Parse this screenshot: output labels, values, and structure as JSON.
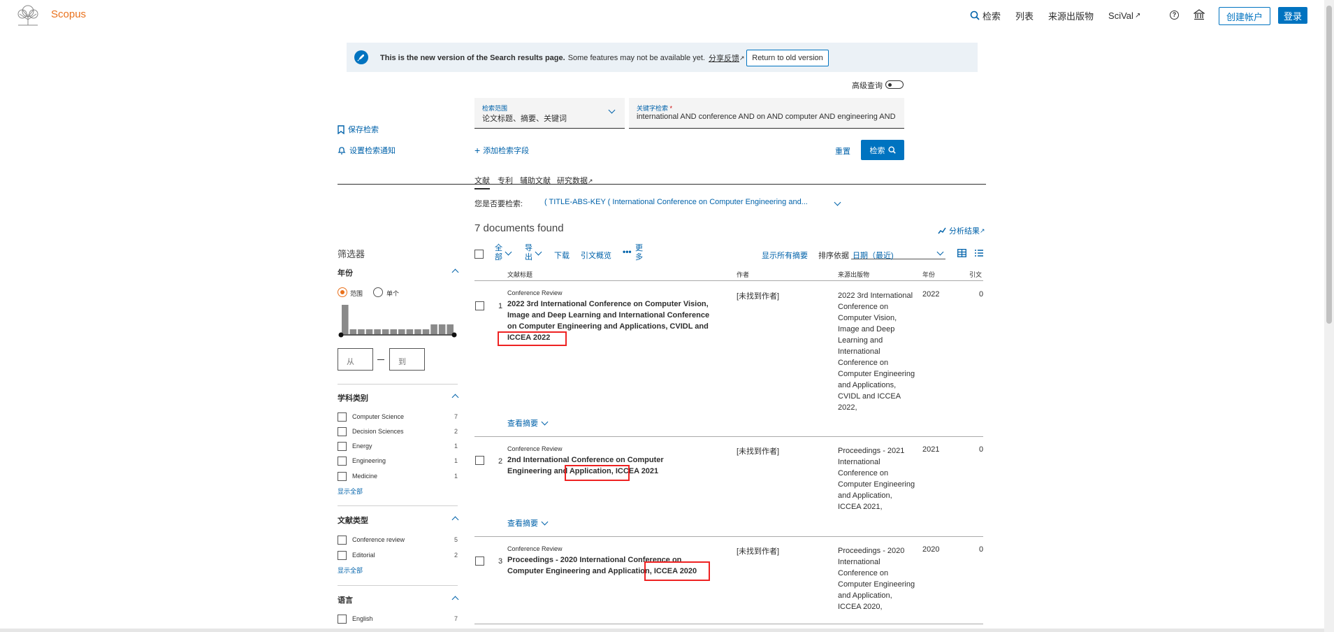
{
  "header": {
    "logo_text": "Scopus",
    "nav": [
      {
        "label": "检索"
      },
      {
        "label": "列表"
      },
      {
        "label": "来源出版物"
      },
      {
        "label": "SciVal"
      }
    ],
    "create_account": "创建帐户",
    "login": "登录"
  },
  "banner": {
    "bold_text": "This is the new version of the Search results page.",
    "text": "Some features may not be available yet.",
    "feedback_link": "分享反馈",
    "return_button": "Return to old version"
  },
  "advanced_toggle_label": "高级查询",
  "search": {
    "scope_label": "检索范围",
    "scope_value": "论文标题、摘要、关键词",
    "keyword_label": "关键字检索",
    "keyword_value": "international AND conference AND on AND computer AND engineering AND",
    "add_field": "添加检索字段",
    "reset": "重置",
    "search_button": "检索"
  },
  "left_actions": {
    "save_search": "保存检索",
    "set_alert": "设置检索通知"
  },
  "tabs": [
    {
      "label": "文献"
    },
    {
      "label": "专利"
    },
    {
      "label": "辅助文献"
    },
    {
      "label": "研究数据"
    }
  ],
  "suggest": {
    "label": "您是否要检索:",
    "query": "( TITLE-ABS-KEY ( International Conference on Computer Engineering and..."
  },
  "results": {
    "count_text": "7 documents found",
    "analyze": "分析结果",
    "toolbar": {
      "all": "全部",
      "export": "导出",
      "download": "下载",
      "citation_overview": "引文概览",
      "more": "更多",
      "show_all_abstracts": "显示所有摘要",
      "sort_label": "排序依据",
      "sort_value": "日期（最近)"
    },
    "columns": {
      "title": "文献标题",
      "authors": "作者",
      "source": "来源出版物",
      "year": "年份",
      "cited": "引文"
    },
    "rows": [
      {
        "num": "1",
        "type": "Conference Review",
        "title": "2022 3rd International Conference on Computer Vision, Image and Deep Learning and International Conference on Computer Engineering and Applications, CVIDL and ICCEA 2022",
        "authors": "[未找到作者]",
        "source": "2022 3rd International Conference on Computer Vision, Image and Deep Learning and International Conference on Computer Engineering and Applications, CVIDL and ICCEA 2022,",
        "year": "2022",
        "cited": "0",
        "abstract_link": "查看摘要"
      },
      {
        "num": "2",
        "type": "Conference Review",
        "title": "2nd International Conference on Computer Engineering and Application, ICCEA 2021",
        "authors": "[未找到作者]",
        "source": "Proceedings - 2021 International Conference on Computer Engineering and Application, ICCEA 2021,",
        "year": "2021",
        "cited": "0",
        "abstract_link": "查看摘要"
      },
      {
        "num": "3",
        "type": "Conference Review",
        "title": "Proceedings - 2020 International Conference on Computer Engineering and Application, ICCEA 2020",
        "authors": "[未找到作者]",
        "source": "Proceedings - 2020 International Conference on Computer Engineering and Application, ICCEA 2020,",
        "year": "2020",
        "cited": "0"
      }
    ]
  },
  "filters": {
    "title": "筛选器",
    "year": {
      "title": "年份",
      "range_label": "范围",
      "single_label": "单个",
      "from_placeholder": "从",
      "to_placeholder": "到",
      "histogram": [
        6,
        1,
        1,
        1,
        1,
        1,
        1,
        1,
        1,
        1,
        1,
        2,
        2,
        2
      ]
    },
    "subject": {
      "title": "学科类别",
      "items": [
        {
          "label": "Computer Science",
          "count": "7"
        },
        {
          "label": "Decision Sciences",
          "count": "2"
        },
        {
          "label": "Energy",
          "count": "1"
        },
        {
          "label": "Engineering",
          "count": "1"
        },
        {
          "label": "Medicine",
          "count": "1"
        }
      ],
      "show_all": "显示全部"
    },
    "doc_type": {
      "title": "文献类型",
      "items": [
        {
          "label": "Conference review",
          "count": "5"
        },
        {
          "label": "Editorial",
          "count": "2"
        }
      ],
      "show_all": "显示全部"
    },
    "language": {
      "title": "语言",
      "items": [
        {
          "label": "English",
          "count": "7"
        }
      ]
    }
  }
}
